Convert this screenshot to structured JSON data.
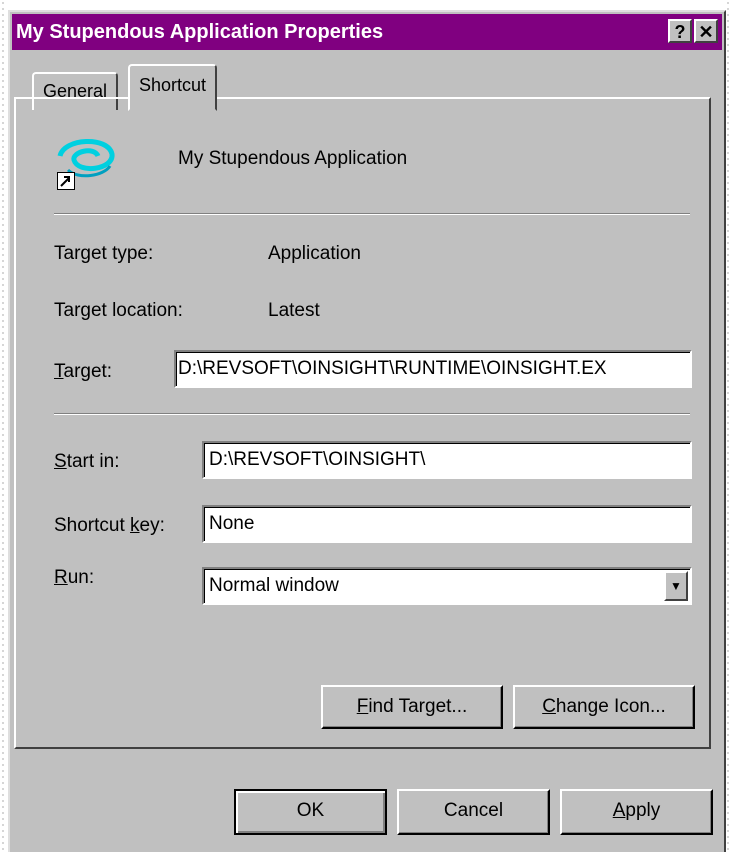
{
  "window": {
    "title": "My Stupendous Application Properties",
    "help_label": "?",
    "close_label": "✕"
  },
  "tabs": [
    {
      "label": "General",
      "active": false
    },
    {
      "label": "Shortcut",
      "active": true
    }
  ],
  "app": {
    "name": "My Stupendous Application",
    "icon": "app-swirl-icon",
    "shortcut_overlay": "shortcut-arrow-icon"
  },
  "info": {
    "target_type_label": "Target type:",
    "target_type_value": "Application",
    "target_location_label": "Target location:",
    "target_location_value": "Latest"
  },
  "fields": {
    "target_label_underlined": "T",
    "target_label_rest": "arget:",
    "target_value": "D:\\REVSOFT\\OINSIGHT\\RUNTIME\\OINSIGHT.EX",
    "start_in_label_underlined": "S",
    "start_in_label_rest": "tart in:",
    "start_in_value": "D:\\REVSOFT\\OINSIGHT\\",
    "shortcut_key_label_pre": "Shortcut ",
    "shortcut_key_label_underlined": "k",
    "shortcut_key_label_rest": "ey:",
    "shortcut_key_value": "None",
    "run_label_underlined": "R",
    "run_label_rest": "un:",
    "run_value": "Normal window"
  },
  "buttons": {
    "find_target_u": "F",
    "find_target_rest": "ind Target...",
    "change_icon_u": "C",
    "change_icon_rest": "hange Icon...",
    "ok": "OK",
    "cancel": "Cancel",
    "apply_u": "A",
    "apply_rest": "pply"
  },
  "colors": {
    "titlebar": "#800080",
    "face": "#c0c0c0"
  }
}
